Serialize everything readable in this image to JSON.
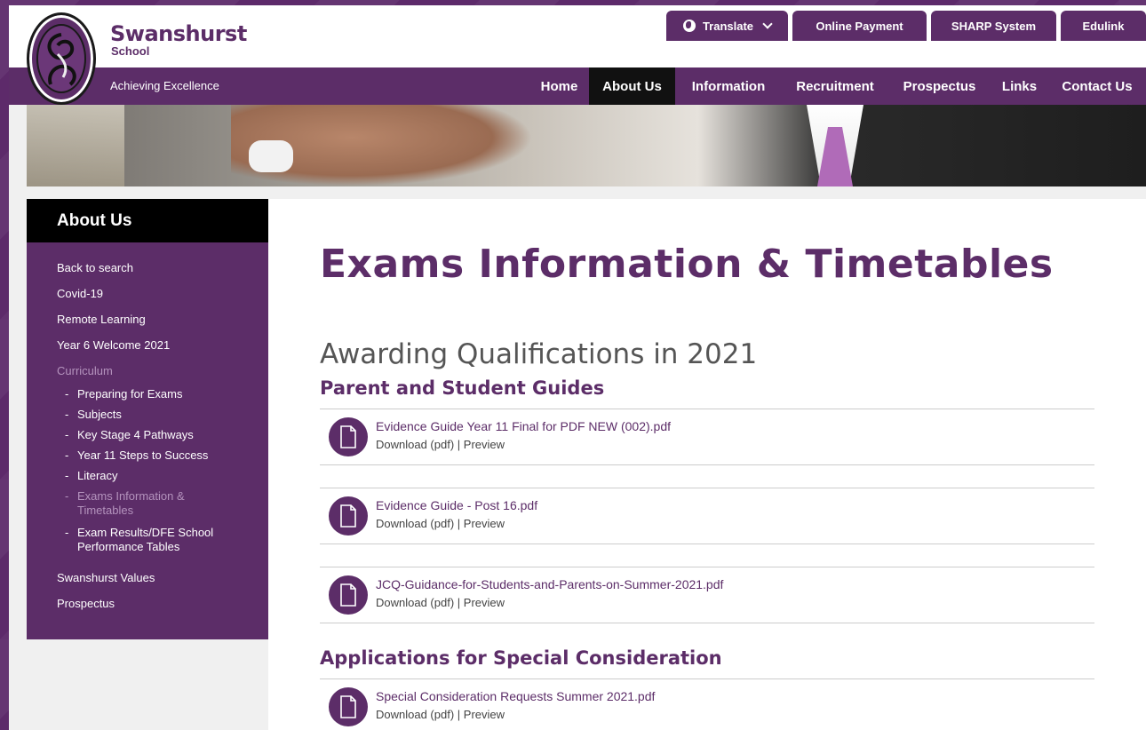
{
  "brand": {
    "name": "Swanshurst",
    "sub": "School",
    "tagline": "Achieving Excellence"
  },
  "top_buttons": {
    "translate": "Translate",
    "online_payment": "Online Payment",
    "sharp": "SHARP System",
    "edulink": "Edulink"
  },
  "nav": {
    "home": "Home",
    "about": "About Us",
    "information": "Information",
    "recruitment": "Recruitment",
    "prospectus": "Prospectus",
    "links": "Links",
    "contact": "Contact Us"
  },
  "sidebar": {
    "title": "About Us",
    "items": {
      "back": "Back to search",
      "covid": "Covid-19",
      "remote": "Remote Learning",
      "year6": "Year 6 Welcome 2021",
      "curriculum": "Curriculum",
      "prep": "Preparing for Exams",
      "subjects": "Subjects",
      "ks4": "Key Stage 4 Pathways",
      "y11": "Year 11 Steps to Success",
      "literacy": "Literacy",
      "exams_l1": "Exams Information &",
      "exams_l2": "Timetables",
      "results_l1": "Exam Results/DFE School",
      "results_l2": "Performance Tables",
      "values": "Swanshurst Values",
      "prospectus": "Prospectus"
    }
  },
  "main": {
    "title": "Exams Information & Timetables",
    "subtitle": "Awarding Qualifications in 2021",
    "section1": "Parent and Student Guides",
    "section2": "Applications for Special Consideration",
    "download_label": "Download (pdf)",
    "separator": "|",
    "preview_label": "Preview",
    "files": [
      "Evidence Guide Year 11 Final for PDF NEW (002).pdf",
      "Evidence Guide - Post 16.pdf",
      "JCQ-Guidance-for-Students-and-Parents-on-Summer-2021.pdf",
      "Special Consideration Requests Summer 2021.pdf"
    ]
  },
  "colors": {
    "brand_purple": "#5c2d68",
    "active_nav": "#111111"
  }
}
